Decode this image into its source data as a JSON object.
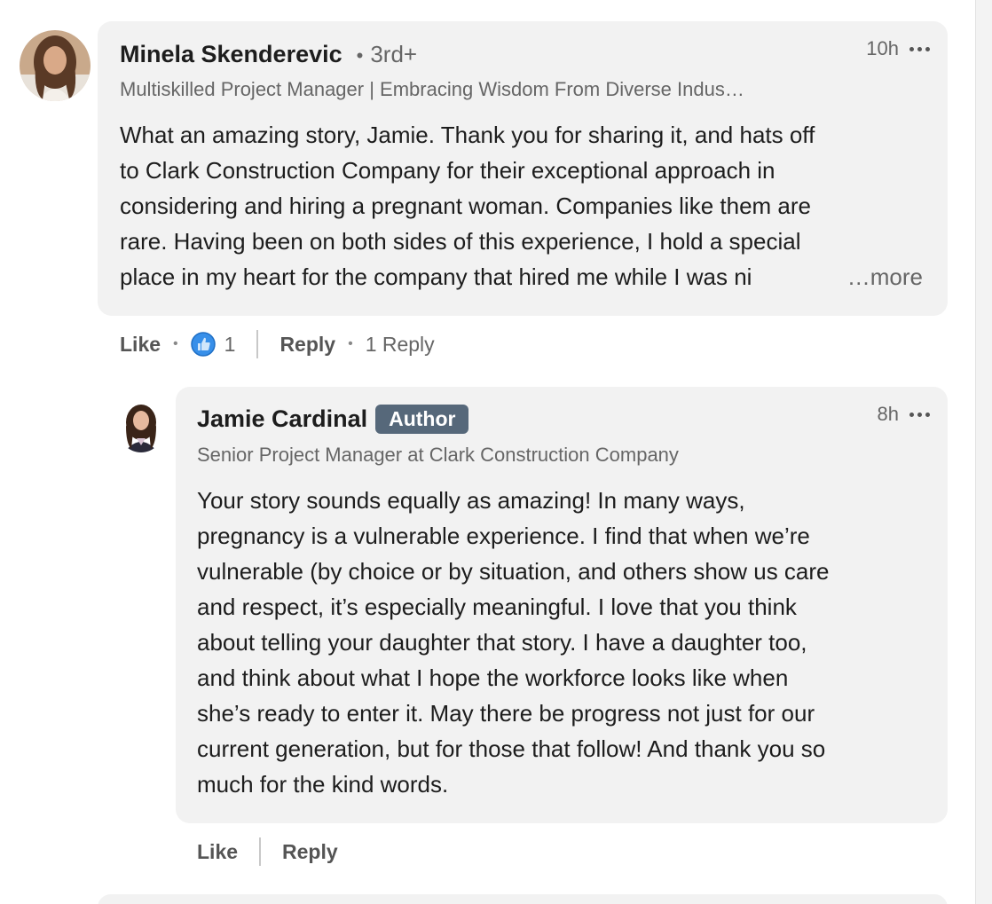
{
  "comment": {
    "author_name": "Minela Skenderevic",
    "connection_degree": "3rd+",
    "headline": "Multiskilled Project Manager | Embracing Wisdom From Diverse Indus…",
    "time": "10h",
    "text_lines": [
      "What an amazing story, Jamie. Thank you for sharing it, and hats off",
      "to Clark Construction Company for their exceptional approach in",
      "considering and hiring a pregnant woman. Companies like them are",
      "rare. Having been on both sides of this experience, I hold a special",
      "place in my heart for the company that hired me while I was ni"
    ],
    "see_more_label": "…more",
    "like_label": "Like",
    "reaction_count": "1",
    "reply_label": "Reply",
    "replies_count_label": "1 Reply",
    "reaction_icon": "like-thumbs-up-icon",
    "reaction_color": "#378fe9"
  },
  "reply": {
    "author_name": "Jamie Cardinal",
    "author_badge": "Author",
    "headline": "Senior Project Manager at Clark Construction Company",
    "time": "8h",
    "text_lines": [
      "Your story sounds equally as amazing! In many ways,",
      "pregnancy is a vulnerable experience. I find that when we’re",
      "vulnerable (by choice or by situation, and others show us care",
      "and respect, it’s especially meaningful. I love that you think",
      "about telling your daughter that story. I have a daughter too,",
      "and think about what I hope the workforce looks like when",
      "she’s ready to enter it. May there be progress not just for our",
      "current generation, but for those that follow! And thank you so",
      "much for the kind words."
    ],
    "like_label": "Like",
    "reply_label": "Reply"
  },
  "colors": {
    "bubble_bg": "#f2f2f2",
    "badge_bg": "#56687a",
    "muted_text": "#666666"
  }
}
